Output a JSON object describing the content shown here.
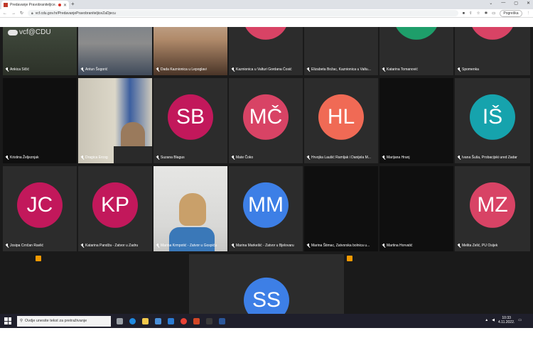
{
  "browser": {
    "tab_title": "Predavanje Pravobraniteljice...",
    "new_tab": "+",
    "url": "vcf.cdu.gov.hr/PredavanjePravobraniteljiceZaDjecu",
    "profile_label": "Pogreška",
    "window_controls": [
      "⌄",
      "—",
      "▢",
      "✕"
    ]
  },
  "watermark": "vcf@CDU",
  "participants": {
    "r0": [
      "Ankica Sičić",
      "Antun Šogorić",
      "Dada Kaznionica u Lepoglavi",
      "Kaznionica u Valturi Gordana Ćosić",
      "Elizabeta Božac, Kaznionica u Valtu...",
      "Katarina Tomanović",
      "Spomenka"
    ],
    "r1": [
      "Kristina Željeznjak",
      "Dragica Ercog",
      "Suzana Blagus",
      "Mate Čoko",
      "Hrvojka Laušić Ramljak i Danijela M...",
      "Marijana Hranj",
      "Ivana Šuša, Probacijski ured Zadar"
    ],
    "r2": [
      "Josipa Crnčan Ravlić",
      "Katarina Pandža - Zatvor u Zadru",
      "Marina Krmpotić - Zatvor u Gospiću",
      "Marina Markešić - Zatvor u Bjelovaru",
      "Marina Štimac, Zatvorska bolnica u...",
      "Martina Horvatić",
      "Melita Zelić, PU Osijek"
    ]
  },
  "initials": {
    "suzana": "SB",
    "mate": "MČ",
    "hrvojka": "HL",
    "ivana": "IŠ",
    "josipa": "JC",
    "katarina": "KP",
    "marina_markesic": "MM",
    "melita": "MZ",
    "bottom": "SS"
  },
  "colors": {
    "magenta": "#c2185b",
    "pink": "#d84365",
    "coral": "#f06a55",
    "teal": "#16a3ad",
    "blue": "#3d7fe6",
    "green": "#1e9e6a"
  },
  "taskbar": {
    "search_placeholder": "Ovdje unesite tekst za pretraživanje",
    "time": "10:33",
    "date": "4.11.2022."
  }
}
